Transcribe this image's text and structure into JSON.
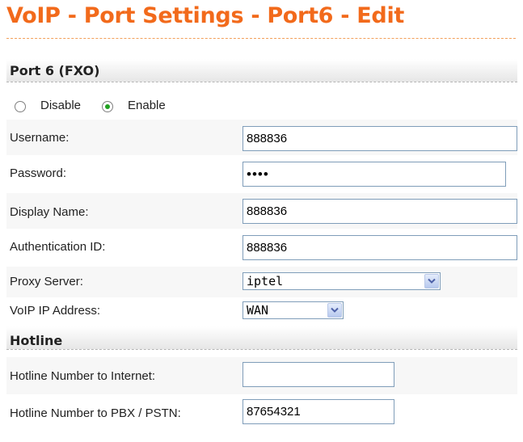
{
  "page": {
    "title": "VoIP - Port Settings - Port6 - Edit"
  },
  "port_section": {
    "heading": "Port 6 (FXO)",
    "status": {
      "options": [
        "Disable",
        "Enable"
      ],
      "selected": "Enable"
    },
    "fields": {
      "username": {
        "label": "Username:",
        "value": "888836"
      },
      "password": {
        "label": "Password:",
        "value": "••••"
      },
      "display_name": {
        "label": "Display Name:",
        "value": "888836"
      },
      "authentication_id": {
        "label": "Authentication ID:",
        "value": "888836"
      },
      "proxy_server": {
        "label": "Proxy Server:",
        "value": "iptel",
        "icon": "chevron-down-icon"
      },
      "voip_ip_address": {
        "label": "VoIP IP Address:",
        "value": "WAN",
        "icon": "chevron-down-icon"
      }
    }
  },
  "hotline_section": {
    "heading": "Hotline",
    "fields": {
      "to_internet": {
        "label": "Hotline Number to Internet:",
        "value": ""
      },
      "to_pbx_pstn": {
        "label": "Hotline Number to PBX / PSTN:",
        "value": "87654321"
      }
    }
  },
  "colors": {
    "title": "#f26a1b",
    "radio_selected": "#21a121",
    "input_border": "#7f9db9"
  }
}
